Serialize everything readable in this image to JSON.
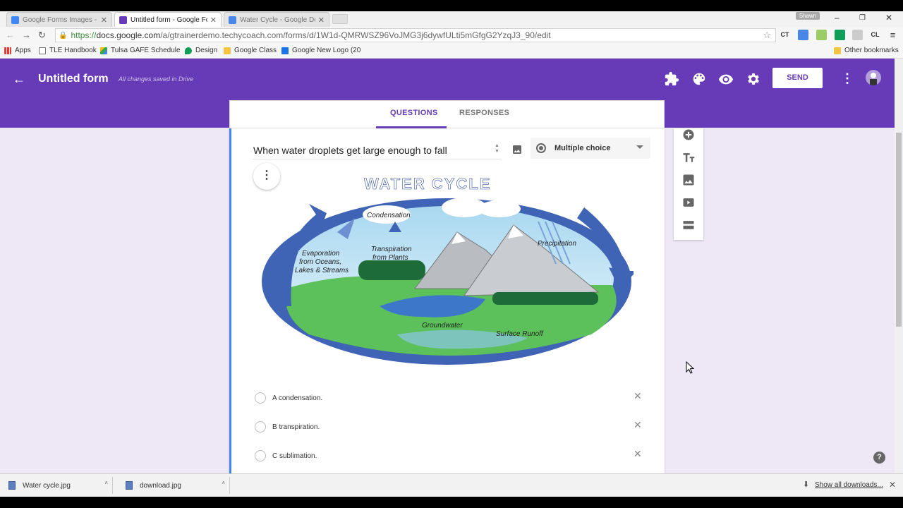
{
  "browser": {
    "tabs": [
      {
        "title": "Google Forms Images - G",
        "active": false
      },
      {
        "title": "Untitled form - Google Fo",
        "active": true
      },
      {
        "title": "Water Cycle - Google Doc",
        "active": false
      }
    ],
    "user_badge": "Shawn",
    "url_scheme": "https://",
    "url_host": "docs.google.com",
    "url_path": "/a/gtrainerdemo.techycoach.com/forms/d/1W1d-QMRWSZ96VoJMG3j6dywfULti5mGfgG2YzqJ3_90/edit",
    "bookmarks": [
      "Apps",
      "TLE Handbook",
      "Tulsa GAFE Schedule",
      "Design",
      "Google Class",
      "Google New Logo (20"
    ],
    "other_bookmarks": "Other bookmarks",
    "ext_labels": [
      "CT",
      "CL"
    ]
  },
  "form": {
    "title": "Untitled form",
    "saved_status": "All changes saved in Drive",
    "send_label": "SEND",
    "tabs": {
      "questions": "QUESTIONS",
      "responses": "RESPONSES"
    },
    "accent_color": "#673ab7",
    "background_color": "#ede7f6"
  },
  "question": {
    "title": "When water droplets get large enough to fall",
    "type": "Multiple choice",
    "image": {
      "heading": "WATER CYCLE",
      "labels": [
        "Condensation",
        "Evaporation",
        "from Oceans,",
        "Lakes & Streams",
        "Transpiration",
        "from Plants",
        "Precipitation",
        "Groundwater",
        "Surface Runoff"
      ]
    },
    "options": [
      "A condensation.",
      "B transpiration.",
      "C sublimation."
    ]
  },
  "sidebar_tools": [
    "add-question-icon",
    "title-text-icon",
    "image-icon",
    "video-icon",
    "section-icon"
  ],
  "downloads": {
    "items": [
      "Water cycle.jpg",
      "download.jpg"
    ],
    "show_all": "Show all downloads..."
  }
}
